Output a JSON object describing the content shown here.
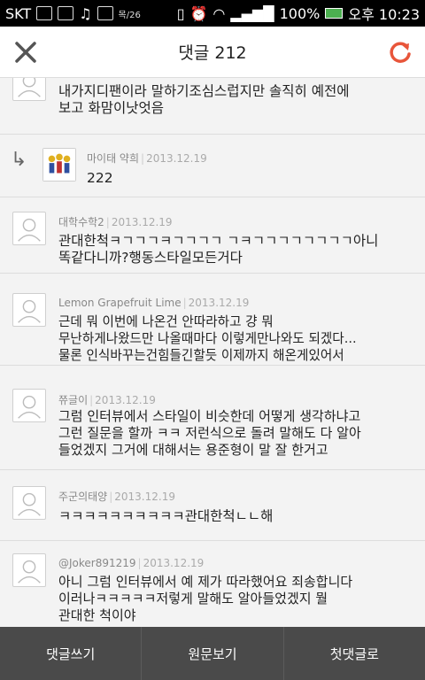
{
  "statusbar": {
    "carrier": "SKT",
    "small_text": "목/26",
    "battery_pct": "100%",
    "time": "오후 10:23"
  },
  "header": {
    "title": "댓글 212",
    "close_icon": "close-icon",
    "refresh_icon": "refresh-icon"
  },
  "comments": [
    {
      "author": "",
      "date": "",
      "body": "내가지디팬이라 말하기조심스럽지만 솔직히 예전에\n보고 화맘이낫엇음",
      "reply": false
    },
    {
      "author": "마이태 약희",
      "date": "2013.12.19",
      "body": "222",
      "reply": true
    },
    {
      "author": "대학수학2",
      "date": "2013.12.19",
      "body": "관대한척ㅋㄱㄱㄱㅋㄱㄱㄱㄱ ㄱㅋㄱㄱㄱㄱㄱㄱㄱㄱ아니\n똑같다니까?행동스타일모든거다",
      "reply": false
    },
    {
      "author": "Lemon Grapefruit Lime",
      "date": "2013.12.19",
      "body": "근데 뭐 이번에 나온건 안따라하고 걍 뭐\n무난하게나왔드만 나올때마다 이렇게만나와도 되겠다...\n물론 인식바꾸는건힘들긴할듯 이제까지 해온게있어서",
      "reply": false
    },
    {
      "author": "쮸글이",
      "date": "2013.12.19",
      "body": "그럼 인터뷰에서 스타일이 비슷한데 어떻게 생각하냐고\n그런 질문을 할까 ㅋㅋ 저런식으로 돌려 말해도 다 알아\n들었겠지 그거에 대해서는 용준형이 말 잘 한거고",
      "reply": false
    },
    {
      "author": "주군의태양",
      "date": "2013.12.19",
      "body": "ㅋㅋㅋㅋㅋㅋㅋㅋㅋㅋ관대한척ㄴㄴ해",
      "reply": false
    },
    {
      "author": "@Joker891219",
      "date": "2013.12.19",
      "body": "아니 그럼 인터뷰에서 예 제가 따라했어요 죄송합니다\n이러나ㅋㅋㅋㅋㅋ저렇게 말해도 알아들었겠지 뭘\n관대한 척이야",
      "reply": false
    }
  ],
  "footer": {
    "write_label": "댓글쓰기",
    "original_label": "원문보기",
    "first_label": "첫댓글로"
  },
  "colors": {
    "accent": "#e8553a",
    "footer_bg": "#4a4a4a"
  }
}
